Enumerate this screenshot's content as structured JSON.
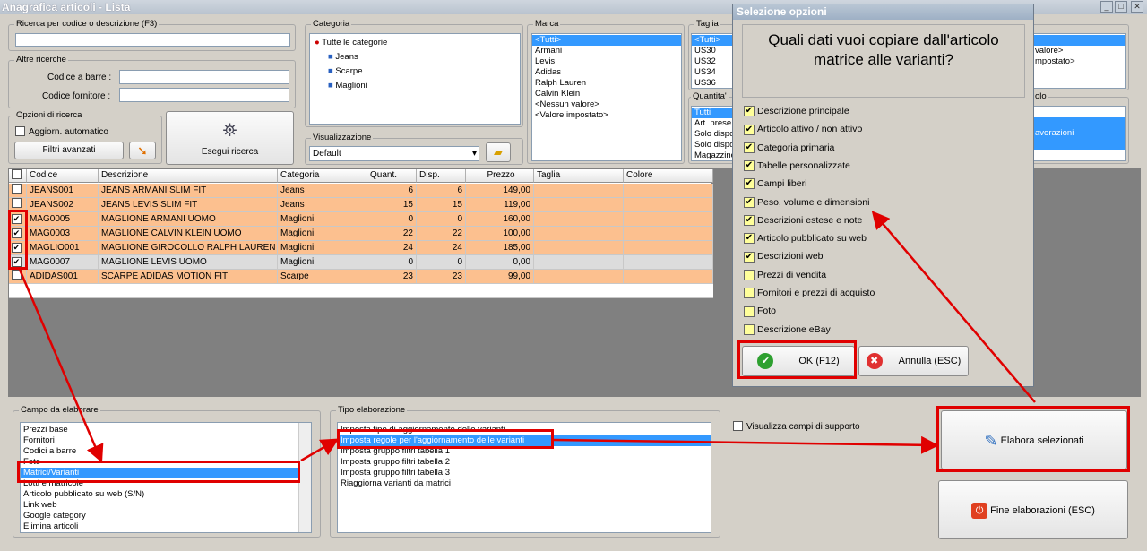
{
  "window": {
    "title": "Anagrafica articoli  - Lista",
    "btn_min": "_",
    "btn_max": "□",
    "btn_close": "✕"
  },
  "search": {
    "label": "Ricerca per codice o descrizione (F3)",
    "value": ""
  },
  "altre": {
    "label": "Altre ricerche",
    "barcode_label": "Codice a barre :",
    "supplier_label": "Codice fornitore :"
  },
  "opzioni": {
    "label": "Opzioni di ricerca",
    "auto_label": "Aggiorn. automatico",
    "filters_btn": "Filtri avanzati",
    "search_btn": "Esegui ricerca"
  },
  "categoria": {
    "label": "Categoria",
    "items": [
      "Tutte le categorie",
      "Jeans",
      "Scarpe",
      "Maglioni"
    ]
  },
  "visualizzazione": {
    "label": "Visualizzazione",
    "value": "Default"
  },
  "marca": {
    "label": "Marca",
    "items": [
      "<Tutti>",
      "Armani",
      "Levis",
      "Adidas",
      "Ralph Lauren",
      "Calvin Klein",
      "<Nessun valore>",
      "<Valore impostato>"
    ]
  },
  "taglia": {
    "label": "Taglia",
    "items": [
      "<Tutti>",
      "US30",
      "US32",
      "US34",
      "US36"
    ]
  },
  "quantita": {
    "label": "Quantita'",
    "items": [
      "Tutti",
      "Art. prese",
      "Solo dispo",
      "Solo dispo",
      "Magazzino"
    ]
  },
  "colore_frag": {
    "items": [
      "valore>",
      "mpostato>"
    ]
  },
  "right_frag": {
    "label": "olo",
    "item": "avorazioni"
  },
  "grid": {
    "headers": [
      "Codice",
      "Descrizione",
      "Categoria",
      "Quant.",
      "Disp.",
      "Prezzo",
      "Taglia",
      "Colore"
    ],
    "rows": [
      {
        "check": "",
        "code": "JEANS001",
        "desc": "JEANS ARMANI SLIM FIT",
        "cat": "Jeans",
        "qty": "6",
        "disp": "6",
        "price": "149,00"
      },
      {
        "check": "",
        "code": "JEANS002",
        "desc": "JEANS LEVIS SLIM  FIT",
        "cat": "Jeans",
        "qty": "15",
        "disp": "15",
        "price": "119,00"
      },
      {
        "check": "✔",
        "code": "MAG0005",
        "desc": "MAGLIONE ARMANI UOMO",
        "cat": "Maglioni",
        "qty": "0",
        "disp": "0",
        "price": "160,00"
      },
      {
        "check": "✔",
        "code": "MAG0003",
        "desc": "MAGLIONE CALVIN KLEIN UOMO",
        "cat": "Maglioni",
        "qty": "22",
        "disp": "22",
        "price": "100,00"
      },
      {
        "check": "✔",
        "code": "MAGLIO001",
        "desc": "MAGLIONE GIROCOLLO RALPH LAUREN",
        "cat": "Maglioni",
        "qty": "24",
        "disp": "24",
        "price": "185,00"
      },
      {
        "check": "✔",
        "code": "MAG0007",
        "desc": "MAGLIONE LEVIS UOMO",
        "cat": "Maglioni",
        "qty": "0",
        "disp": "0",
        "price": "0,00"
      },
      {
        "check": "",
        "code": "ADIDAS001",
        "desc": "SCARPE ADIDAS MOTION FIT",
        "cat": "Scarpe",
        "qty": "23",
        "disp": "23",
        "price": "99,00"
      }
    ]
  },
  "campo": {
    "label": "Campo da elaborare",
    "items": [
      "Prezzi base",
      "Fornitori",
      "Codici a barre",
      "Foto",
      "Matrici/Varianti",
      "Lotti e matricole",
      "Articolo pubblicato su web (S/N)",
      "Link web",
      "Google category",
      "Elimina articoli"
    ]
  },
  "tipo": {
    "label": "Tipo elaborazione",
    "items": [
      "Imposta tipo di aggiornamento delle varianti",
      "Imposta regole per l'aggiornamento delle varianti",
      "Imposta gruppo filtri tabella 1",
      "Imposta gruppo filtri tabella 2",
      "Imposta gruppo filtri tabella 3",
      "Riaggiorna varianti da matrici"
    ]
  },
  "support": {
    "label": "Visualizza campi di supporto"
  },
  "actions": {
    "elabora": "Elabora selezionati",
    "fine": "Fine elaborazioni (ESC)"
  },
  "dialog": {
    "title": "Selezione opzioni",
    "question": "Quali dati vuoi copiare dall'articolo matrice alle varianti?",
    "options": [
      {
        "label": "Descrizione principale",
        "checked": "✔"
      },
      {
        "label": "Articolo attivo / non attivo",
        "checked": "✔"
      },
      {
        "label": "Categoria primaria",
        "checked": "✔"
      },
      {
        "label": "Tabelle personalizzate",
        "checked": "✔"
      },
      {
        "label": "Campi liberi",
        "checked": "✔"
      },
      {
        "label": "Peso, volume e dimensioni",
        "checked": "✔"
      },
      {
        "label": "Descrizioni estese e note",
        "checked": "✔"
      },
      {
        "label": "Articolo pubblicato su web",
        "checked": "✔"
      },
      {
        "label": "Descrizioni web",
        "checked": "✔"
      },
      {
        "label": "Prezzi di vendita",
        "checked": ""
      },
      {
        "label": "Fornitori e prezzi di acquisto",
        "checked": ""
      },
      {
        "label": "Foto",
        "checked": ""
      },
      {
        "label": "Descrizione eBay",
        "checked": ""
      }
    ],
    "ok": "OK (F12)",
    "cancel": "Annulla (ESC)"
  },
  "colors": {
    "highlight": "#e00000",
    "row_orange": "#fcc08f",
    "selection": "#3399ff"
  }
}
